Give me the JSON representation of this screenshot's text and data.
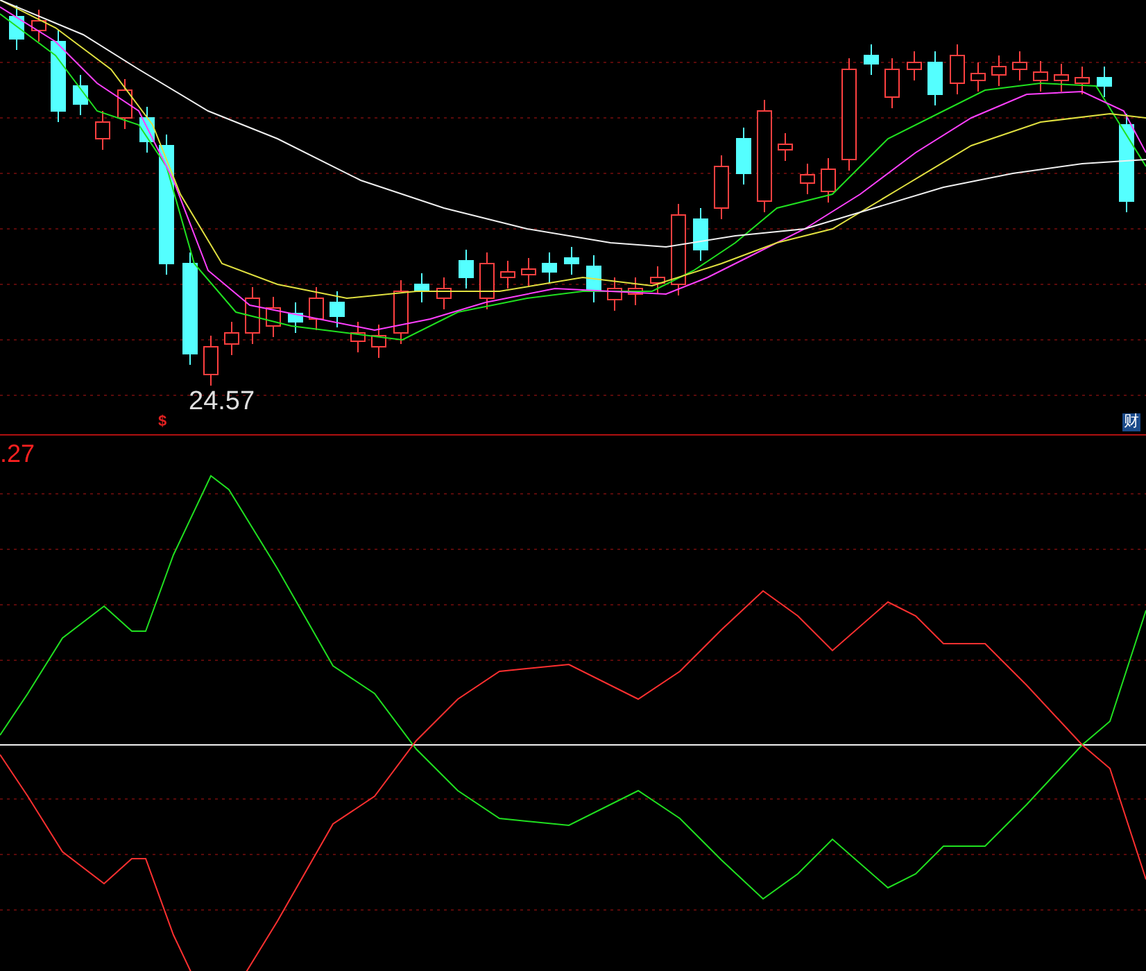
{
  "price_pane": {
    "low_label": "24.57",
    "event_marker": "$",
    "finance_badge": "财"
  },
  "indicator_pane": {
    "value_label": ".27"
  }
}
